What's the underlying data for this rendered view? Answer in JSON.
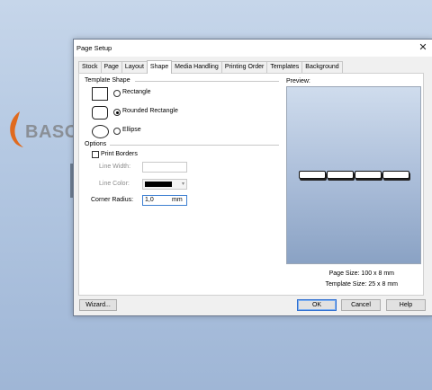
{
  "background": {
    "logo_text": "BASO",
    "colors": {
      "logo_swoosh": "#e06a1e",
      "logo_text": "#8a8f96"
    }
  },
  "dialog": {
    "title": "Page Setup",
    "close_icon": "close-icon",
    "tabs": [
      {
        "label": "Stock",
        "active": false
      },
      {
        "label": "Page",
        "active": false
      },
      {
        "label": "Layout",
        "active": false
      },
      {
        "label": "Shape",
        "active": true
      },
      {
        "label": "Media Handling",
        "active": false
      },
      {
        "label": "Printing Order",
        "active": false
      },
      {
        "label": "Templates",
        "active": false
      },
      {
        "label": "Background",
        "active": false
      }
    ],
    "template_shape": {
      "group_label": "Template Shape",
      "options": [
        {
          "label": "Rectangle",
          "checked": false
        },
        {
          "label": "Rounded Rectangle",
          "checked": true
        },
        {
          "label": "Ellipse",
          "checked": false
        }
      ]
    },
    "options": {
      "group_label": "Options",
      "print_borders_label": "Print Borders",
      "print_borders_checked": false,
      "line_width_label": "Line Width:",
      "line_width_value": "",
      "line_color_label": "Line Color:",
      "line_color_value": "#000000",
      "corner_radius_label": "Corner Radius:",
      "corner_radius_value": "1,0",
      "corner_radius_unit": "mm"
    },
    "preview": {
      "label": "Preview:",
      "label_count": 4,
      "page_size_label": "Page Size:",
      "page_size_value": "100 x 8 mm",
      "template_size_label": "Template Size:",
      "template_size_value": "25 x 8 mm"
    },
    "buttons": {
      "wizard": "Wizard...",
      "ok": "OK",
      "cancel": "Cancel",
      "help": "Help"
    }
  }
}
